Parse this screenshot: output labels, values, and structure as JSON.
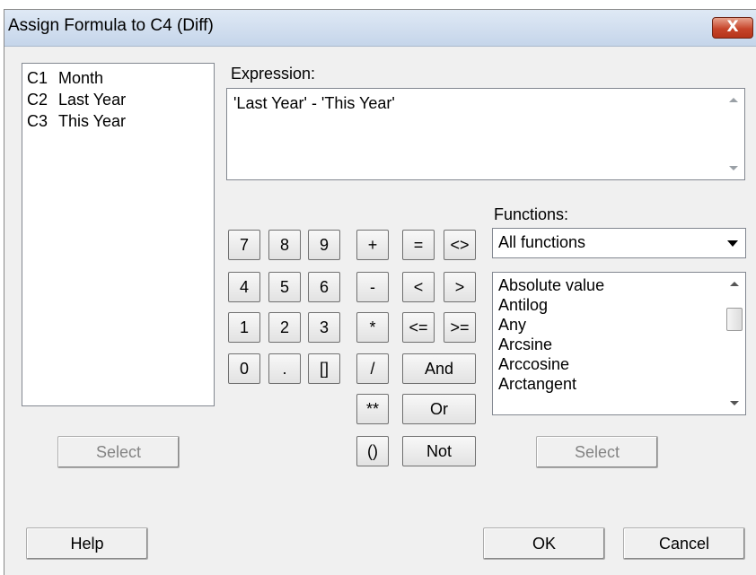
{
  "window": {
    "title": "Assign Formula to C4 (Diff)",
    "close_glyph": "X"
  },
  "columns": [
    {
      "id": "C1",
      "name": "Month"
    },
    {
      "id": "C2",
      "name": "Last Year"
    },
    {
      "id": "C3",
      "name": "This Year"
    }
  ],
  "left_select_label": "Select",
  "expression": {
    "label": "Expression:",
    "value": "'Last Year' - 'This Year'"
  },
  "keypad": {
    "row1": [
      "7",
      "8",
      "9",
      "+",
      "=",
      "<>"
    ],
    "row2": [
      "4",
      "5",
      "6",
      "-",
      "<",
      ">"
    ],
    "row3": [
      "1",
      "2",
      "3",
      "*",
      "<=",
      ">="
    ],
    "row4": [
      "0",
      ".",
      "[]",
      "/",
      "And"
    ],
    "row5": [
      "**",
      "Or"
    ],
    "row6": [
      "()",
      "Not"
    ]
  },
  "functions": {
    "label": "Functions:",
    "category": "All functions",
    "items": [
      "Absolute value",
      "Antilog",
      "Any",
      "Arcsine",
      "Arccosine",
      "Arctangent"
    ]
  },
  "right_select_label": "Select",
  "help_label": "Help",
  "ok_label": "OK",
  "cancel_label": "Cancel",
  "colors": {
    "title_bar": "#c5d5ea",
    "dialog_bg": "#f0f0f0",
    "close_red": "#c7452b"
  }
}
